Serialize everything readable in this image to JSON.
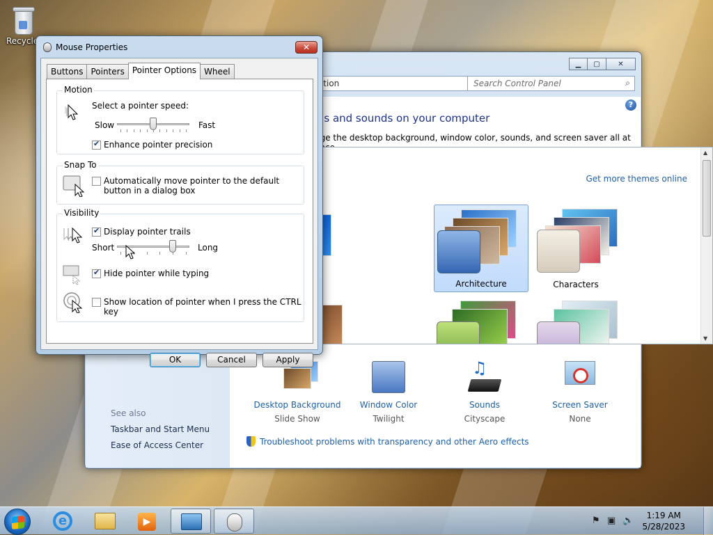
{
  "desktop": {
    "recycle_label": "Recycle"
  },
  "personalization": {
    "address_text": "nalization",
    "search_placeholder": "Search Control Panel",
    "heading": "als and sounds on your computer",
    "subtext": "nge the desktop background, window color, sounds, and screen saver all at once.",
    "get_themes_link": "Get more themes online",
    "themes": [
      {
        "label": "Architecture",
        "selected": true
      },
      {
        "label": "Characters",
        "selected": false
      }
    ],
    "bottom_items": [
      {
        "name": "Desktop Background",
        "value": "Slide Show"
      },
      {
        "name": "Window Color",
        "value": "Twilight"
      },
      {
        "name": "Sounds",
        "value": "Cityscape"
      },
      {
        "name": "Screen Saver",
        "value": "None"
      }
    ],
    "see_also_label": "See also",
    "see_also_links": [
      "Taskbar and Start Menu",
      "Ease of Access Center"
    ],
    "troubleshoot_link": "Troubleshoot problems with transparency and other Aero effects"
  },
  "mouse_dialog": {
    "title": "Mouse Properties",
    "close_label": "✕",
    "tabs": [
      {
        "label": "Buttons",
        "active": false
      },
      {
        "label": "Pointers",
        "active": false
      },
      {
        "label": "Pointer Options",
        "active": true
      },
      {
        "label": "Wheel",
        "active": false
      }
    ],
    "motion": {
      "group_title": "Motion",
      "speed_label": "Select a pointer speed:",
      "slow": "Slow",
      "fast": "Fast",
      "speed_level": 0.5,
      "enhance_label": "Enhance pointer precision",
      "enhance_checked": true
    },
    "snap_to": {
      "group_title": "Snap To",
      "auto_move_label": "Automatically move pointer to the default button in a dialog box",
      "auto_move_checked": false
    },
    "visibility": {
      "group_title": "Visibility",
      "trails_label": "Display pointer trails",
      "trails_checked": true,
      "short": "Short",
      "long": "Long",
      "trails_level": 0.8,
      "hide_label": "Hide pointer while typing",
      "hide_checked": true,
      "ctrl_label": "Show location of pointer when I press the CTRL key",
      "ctrl_checked": false
    },
    "buttons": {
      "ok": "OK",
      "cancel": "Cancel",
      "apply": "Apply"
    }
  },
  "taskbar": {
    "time": "1:19 AM",
    "date": "5/28/2023"
  }
}
